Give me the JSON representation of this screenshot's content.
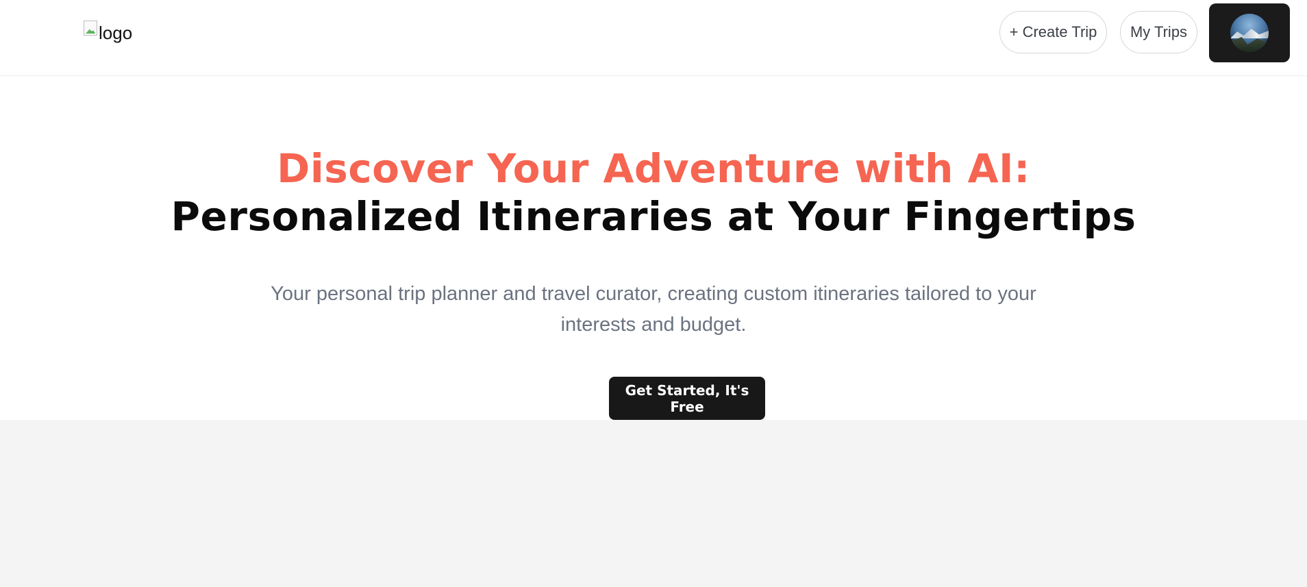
{
  "header": {
    "logo_alt": "logo",
    "create_trip_label": "+ Create Trip",
    "my_trips_label": "My Trips",
    "avatar_icon": "user-avatar-icon"
  },
  "hero": {
    "headline_accent": "Discover Your Adventure with AI:",
    "headline_main": "Personalized Itineraries at Your Fingertips",
    "subtitle": "Your personal trip planner and travel curator, creating custom itineraries tailored to your interests and budget.",
    "cta_label": "Get Started, It's Free"
  },
  "colors": {
    "accent": "#f56551",
    "cta_background": "#181818",
    "subtitle_text": "#6b7280",
    "section_background": "#f4f4f4"
  }
}
